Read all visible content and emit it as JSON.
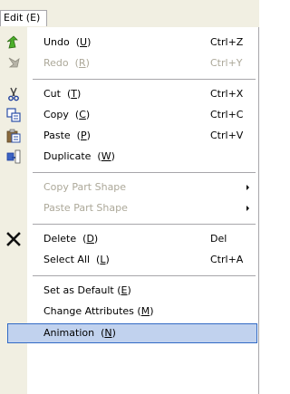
{
  "menubar": {
    "title": "Edit (E)"
  },
  "items": [
    {
      "pre": "Undo  (",
      "key": "U",
      "post": ")",
      "shortcut": "Ctrl+Z",
      "icon": "undo-icon",
      "enabled": true
    },
    {
      "pre": "Redo  (",
      "key": "R",
      "post": ")",
      "shortcut": "Ctrl+Y",
      "icon": "redo-icon",
      "enabled": false
    },
    {
      "pre": "Cut  (",
      "key": "T",
      "post": ")",
      "shortcut": "Ctrl+X",
      "icon": "scissors-icon",
      "enabled": true
    },
    {
      "pre": "Copy  (",
      "key": "C",
      "post": ")",
      "shortcut": "Ctrl+C",
      "icon": "copy-icon",
      "enabled": true
    },
    {
      "pre": "Paste  (",
      "key": "P",
      "post": ")",
      "shortcut": "Ctrl+V",
      "icon": "clipboard-icon",
      "enabled": true
    },
    {
      "pre": "Duplicate  (",
      "key": "W",
      "post": ")",
      "shortcut": "",
      "icon": "duplicate-icon",
      "enabled": true
    },
    {
      "label": "Copy Part Shape",
      "submenu": true,
      "enabled": false
    },
    {
      "label": "Paste Part Shape",
      "submenu": true,
      "enabled": false
    },
    {
      "pre": "Delete  (",
      "key": "D",
      "post": ")",
      "shortcut": "Del",
      "icon": "delete-x-icon",
      "enabled": true
    },
    {
      "pre": "Select All  (",
      "key": "L",
      "post": ")",
      "shortcut": "Ctrl+A",
      "enabled": true
    },
    {
      "pre": "Set as Default (",
      "key": "E",
      "post": ")",
      "enabled": true
    },
    {
      "pre": "Change Attributes (",
      "key": "M",
      "post": ")",
      "enabled": true
    },
    {
      "pre": "Animation  (",
      "key": "N",
      "post": ")",
      "enabled": true,
      "highlighted": true
    }
  ],
  "colors": {
    "gutter": "#f1efe2",
    "separator": "#a7a6aa",
    "disabled_text": "#aca899",
    "highlight_fill": "#c1d2ee",
    "highlight_border": "#316ac5"
  }
}
